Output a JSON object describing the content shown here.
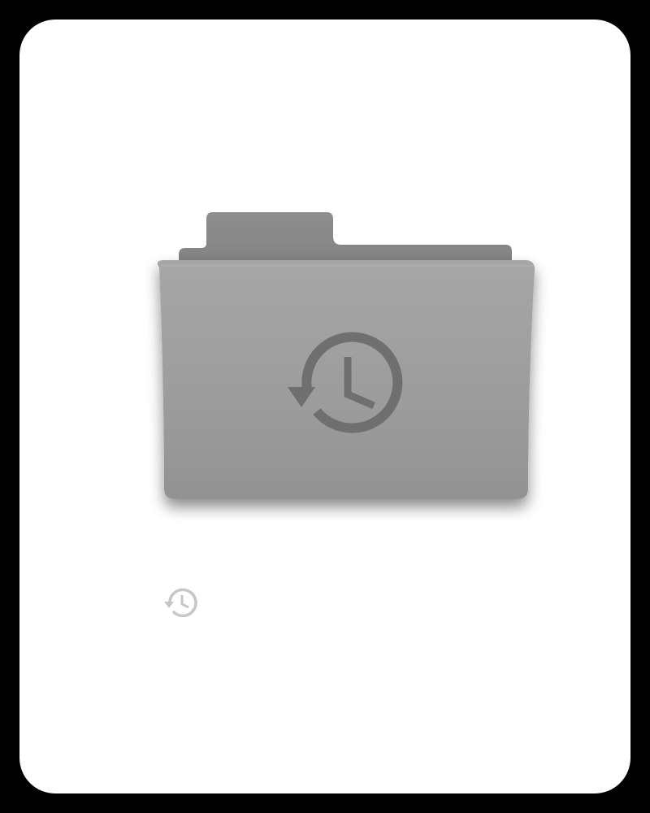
{
  "canvas": {
    "frame_color": "#000000",
    "card_color": "#ffffff"
  },
  "large_icon": {
    "icon": "history-folder-icon",
    "folder_color": "#9a9a9a",
    "tab_color": "#858585",
    "glyph_color": "#6f6f6f"
  },
  "small_icon": {
    "icon": "history-icon",
    "color": "#c7c7c7"
  }
}
